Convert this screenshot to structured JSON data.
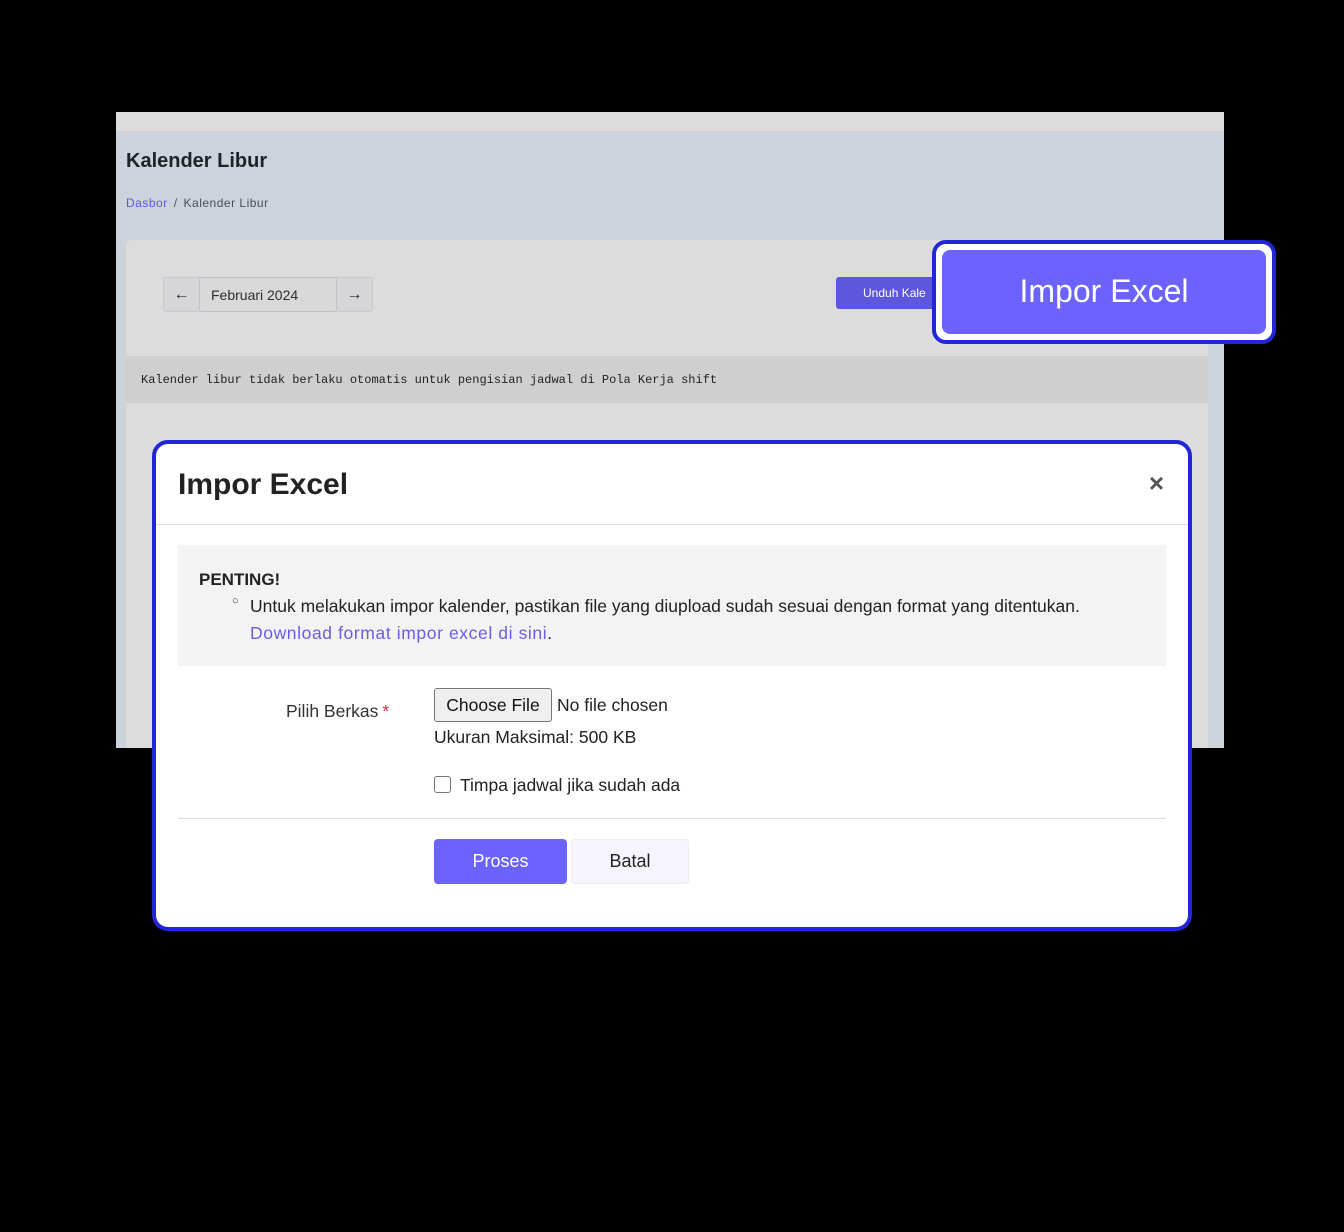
{
  "page": {
    "title": "Kalender Libur",
    "breadcrumb": {
      "home": "Dasbor",
      "separator": "/",
      "current": "Kalender Libur"
    },
    "month_nav": {
      "prev_icon": "arrow-left-icon",
      "month": "Februari 2024",
      "next_icon": "arrow-right-icon"
    },
    "download_label": "Unduh Kale",
    "notice": "Kalender libur tidak berlaku otomatis untuk pengisian jadwal di Pola Kerja shift"
  },
  "callout": {
    "label": "Impor Excel",
    "accent": "#6c63fe",
    "border": "#2226d6"
  },
  "modal": {
    "title": "Impor Excel",
    "close": "×",
    "info": {
      "heading": "PENTING!",
      "bullet": "○",
      "text": "Untuk melakukan impor kalender, pastikan file yang diupload sudah sesuai dengan format yang ditentukan.",
      "link": "Download format impor excel di sini",
      "link_suffix": "."
    },
    "file_field": {
      "label": "Pilih Berkas",
      "required_mark": "*",
      "button": "Choose File",
      "status": "No file chosen",
      "max_size": "Ukuran Maksimal: 500 KB"
    },
    "overwrite_checkbox": {
      "label": "Timpa jadwal jika sudah ada",
      "checked": false
    },
    "buttons": {
      "submit": "Proses",
      "cancel": "Batal"
    }
  }
}
